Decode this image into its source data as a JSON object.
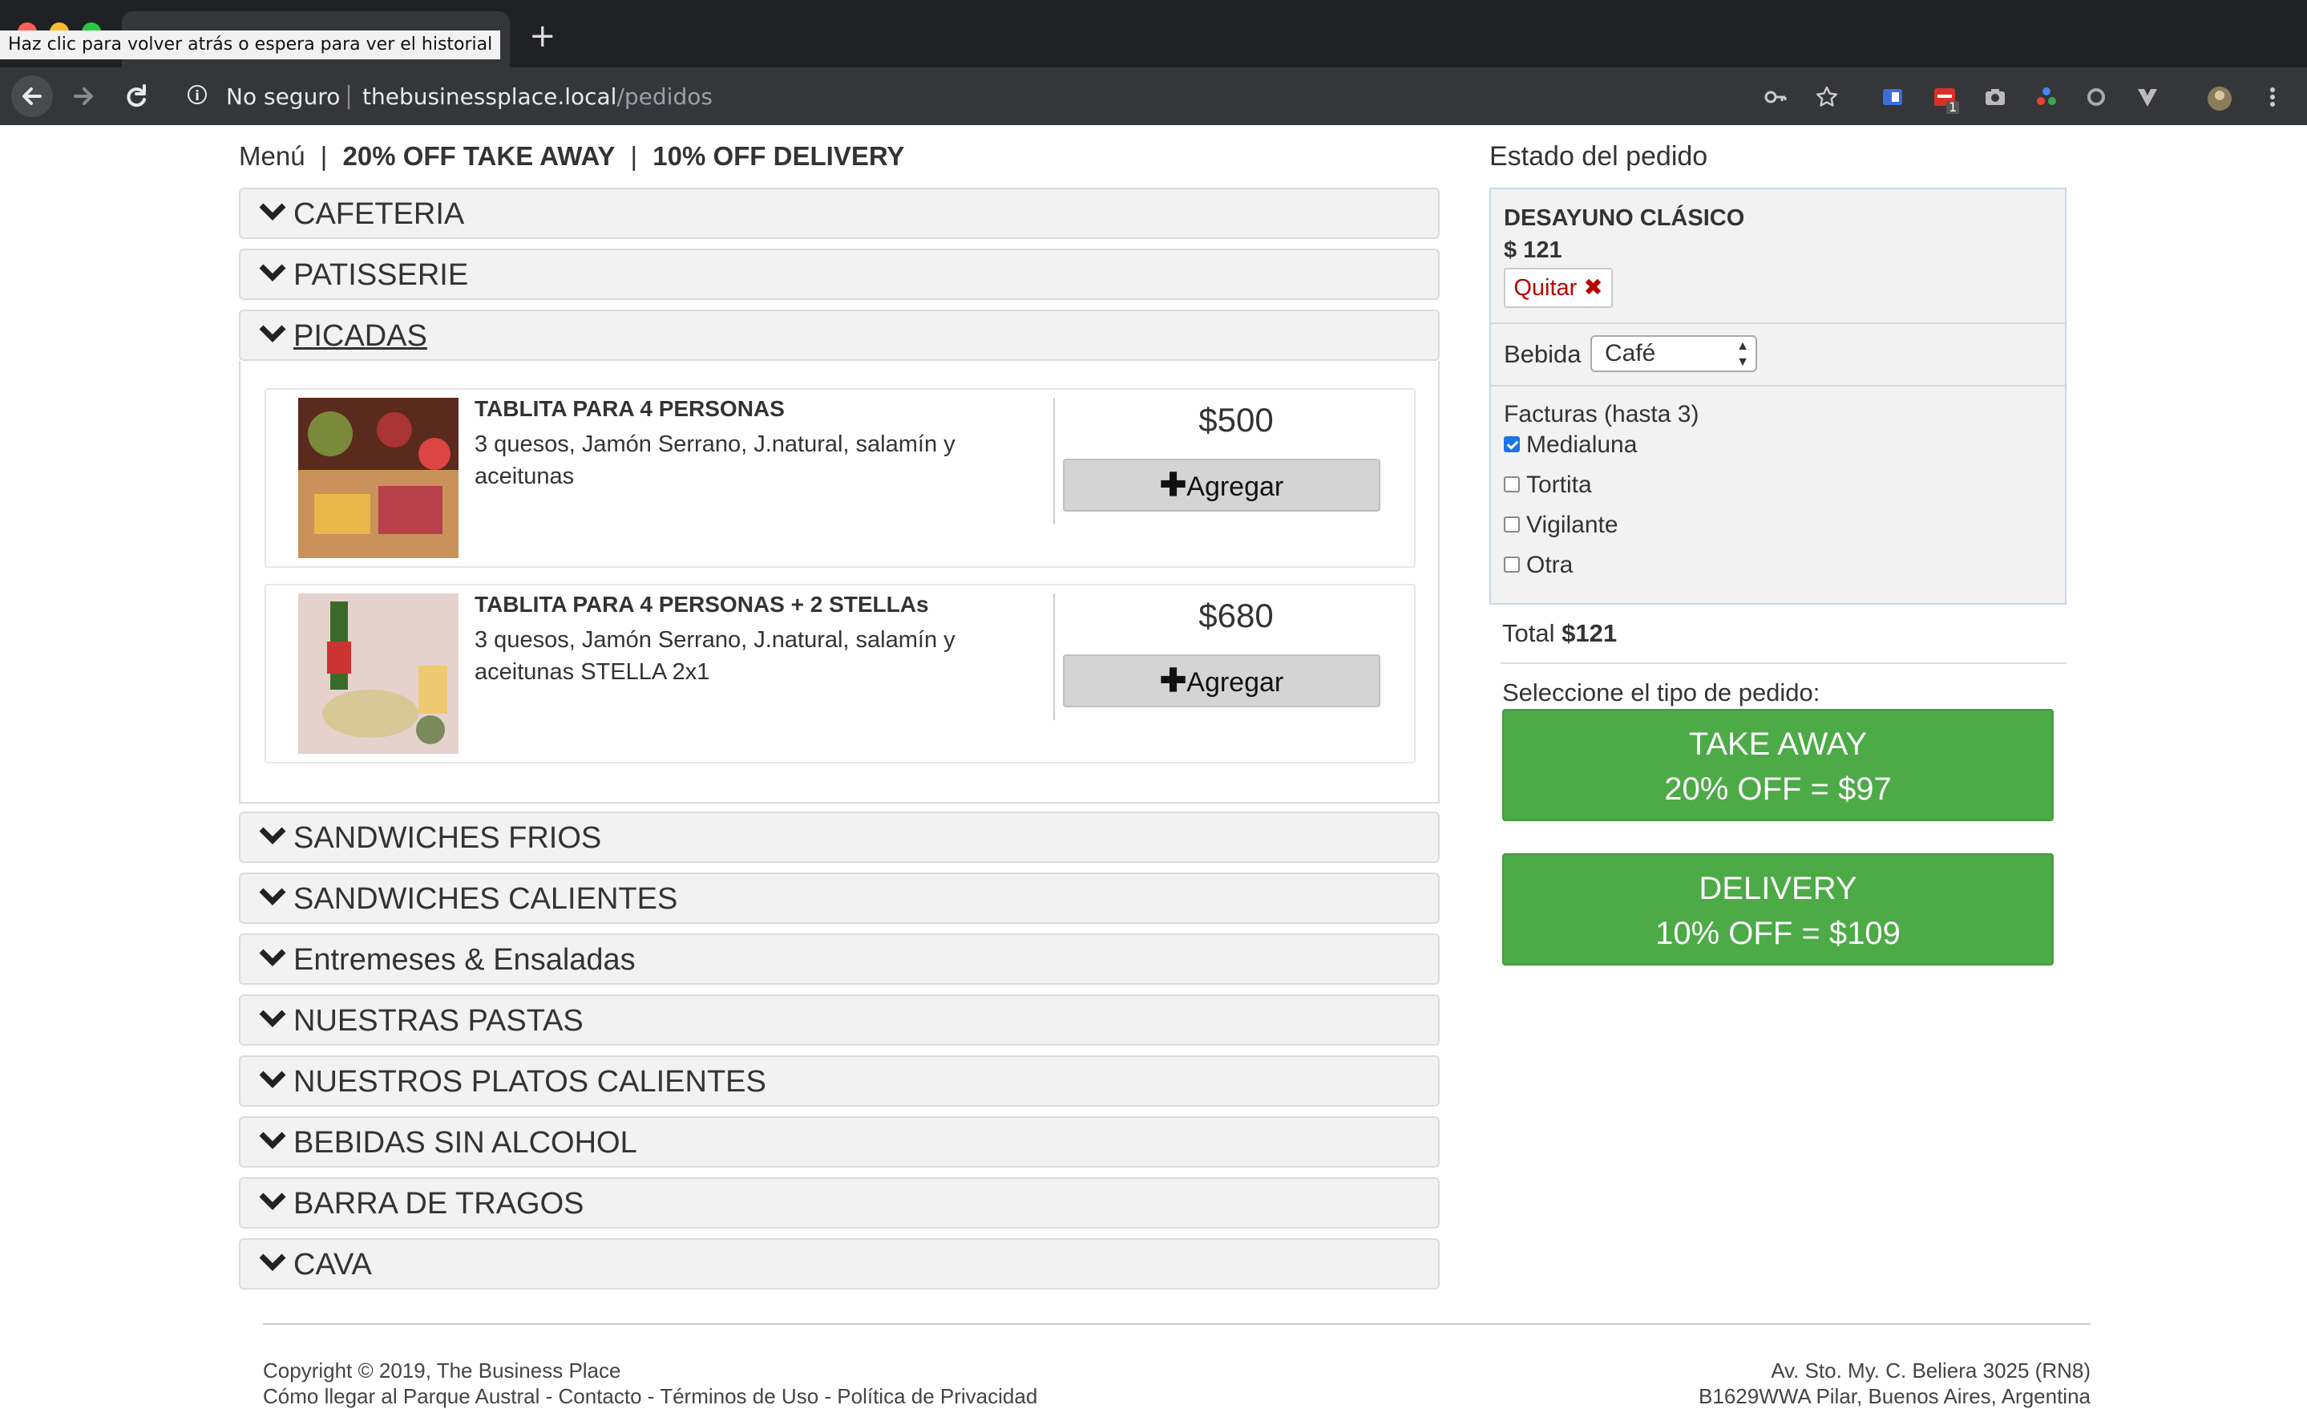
{
  "browser": {
    "tooltip": "Haz clic para volver atrás o espera para ver el historial",
    "tab_close": "✕",
    "new_tab": "+",
    "security": "No seguro",
    "host": "thebusinessplace.local",
    "path": "/pedidos",
    "extension_badge": "1"
  },
  "menu": {
    "title": "Menú",
    "sep": "|",
    "promo_takeaway": "20% OFF TAKE AWAY",
    "promo_delivery": "10% OFF DELIVERY",
    "categories_top": [
      "CAFETERIA",
      "PATISSERIE",
      "PICADAS"
    ],
    "categories_bottom": [
      "SANDWICHES FRIOS",
      "SANDWICHES CALIENTES",
      "Entremeses & Ensaladas",
      "NUESTRAS PASTAS",
      "NUESTROS PLATOS CALIENTES",
      "BEBIDAS SIN ALCOHOL",
      "BARRA DE TRAGOS",
      "CAVA"
    ],
    "products": [
      {
        "name": "TABLITA PARA 4 PERSONAS",
        "description": "3 quesos, Jamón Serrano, J.natural, salamín y aceitunas",
        "price": "$500",
        "button": "Agregar"
      },
      {
        "name": "TABLITA PARA 4 PERSONAS + 2 STELLAs",
        "description": "3 quesos, Jamón Serrano, J.natural, salamín y aceitunas STELLA 2x1",
        "price": "$680",
        "button": "Agregar"
      }
    ]
  },
  "order": {
    "title": "Estado del pedido",
    "item_name": "DESAYUNO CLÁSICO",
    "item_price": "$ 121",
    "remove_label": "Quitar",
    "remove_icon": "✖",
    "drink_label": "Bebida",
    "drink_value": "Café",
    "pastries_label": "Facturas (hasta 3)",
    "pastries": [
      {
        "label": "Medialuna",
        "checked": true
      },
      {
        "label": "Tortita",
        "checked": false
      },
      {
        "label": "Vigilante",
        "checked": false
      },
      {
        "label": "Otra",
        "checked": false
      }
    ],
    "total_label": "Total",
    "total_value": "$121",
    "select_type_label": "Seleccione el tipo de pedido:",
    "takeaway_line1": "TAKE AWAY",
    "takeaway_line2": "20% OFF = $97",
    "delivery_line1": "DELIVERY",
    "delivery_line2": "10% OFF = $109",
    "button_color": "#4caa47"
  },
  "footer": {
    "copyright": "Copyright © 2019, The Business Place",
    "links": "Cómo llegar al Parque Austral - Contacto - Términos de Uso - Política de Privacidad",
    "address1": "Av. Sto. My. C. Beliera 3025 (RN8)",
    "address2": "B1629WWA Pilar, Buenos Aires, Argentina"
  }
}
